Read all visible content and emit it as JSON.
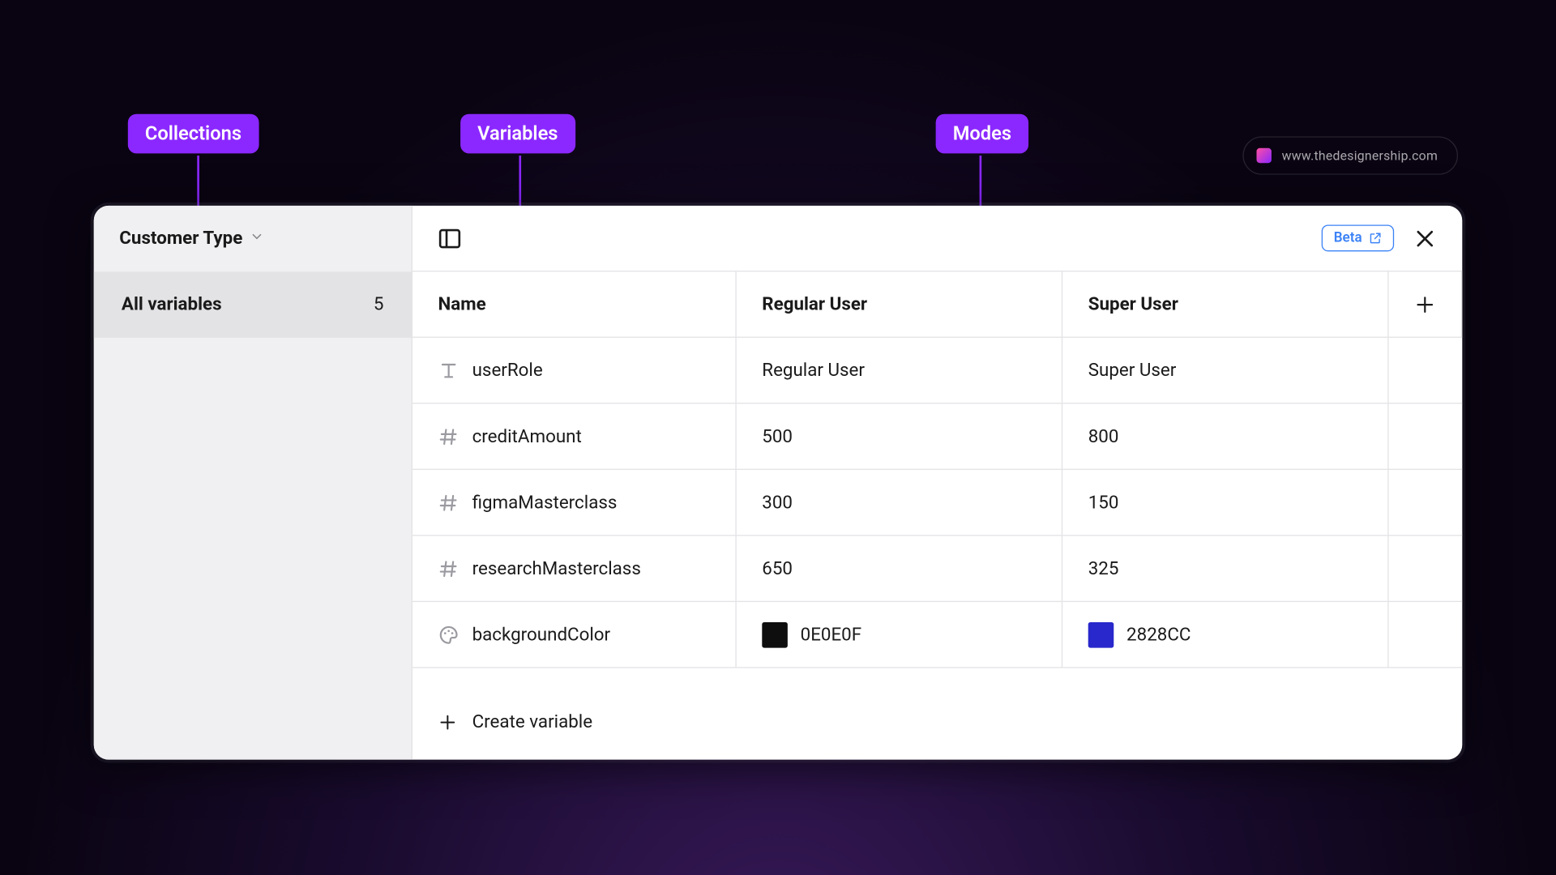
{
  "annotations": {
    "collections": "Collections",
    "variables": "Variables",
    "modes": "Modes"
  },
  "watermark": {
    "text": "www.thedesignership.com"
  },
  "sidebar": {
    "collection_name": "Customer Type",
    "group_label": "All variables",
    "group_count": "5"
  },
  "topbar": {
    "beta_label": "Beta"
  },
  "table": {
    "headers": {
      "name": "Name",
      "mode1": "Regular User",
      "mode2": "Super User"
    },
    "rows": [
      {
        "type": "text",
        "name": "userRole",
        "v1": "Regular User",
        "v2": "Super User"
      },
      {
        "type": "number",
        "name": "creditAmount",
        "v1": "500",
        "v2": "800"
      },
      {
        "type": "number",
        "name": "figmaMasterclass",
        "v1": "300",
        "v2": "150"
      },
      {
        "type": "number",
        "name": "researchMasterclass",
        "v1": "650",
        "v2": "325"
      },
      {
        "type": "color",
        "name": "backgroundColor",
        "v1": "0E0E0F",
        "c1": "#0E0E0F",
        "v2": "2828CC",
        "c2": "#2828CC"
      }
    ],
    "create_label": "Create variable"
  }
}
